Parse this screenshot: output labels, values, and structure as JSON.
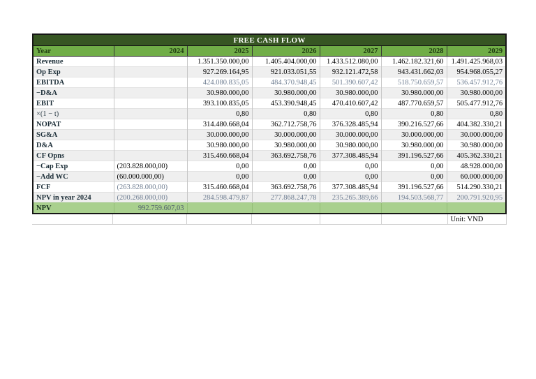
{
  "table": {
    "title": "FREE CASH FLOW",
    "unit_note": "Unit: VND",
    "header": {
      "label": "Year",
      "years": [
        "2024",
        "2025",
        "2026",
        "2027",
        "2028",
        "2029"
      ]
    },
    "rows": [
      {
        "label": "Revenue",
        "values": [
          "",
          "1.351.350.000,00",
          "1.405.404.000,00",
          "1.433.512.080,00",
          "1.462.182.321,60",
          "1.491.425.968,03"
        ],
        "muted": "none"
      },
      {
        "label": "Op Exp",
        "values": [
          "",
          "927.269.164,95",
          "921.033.051,55",
          "932.121.472,58",
          "943.431.662,03",
          "954.968.055,27"
        ],
        "muted": "none"
      },
      {
        "label": "EBITDA",
        "values": [
          "",
          "424.080.835,05",
          "484.370.948,45",
          "501.390.607,42",
          "518.750.659,57",
          "536.457.912,76"
        ],
        "muted": "all"
      },
      {
        "label": "−D&A",
        "values": [
          "",
          "30.980.000,00",
          "30.980.000,00",
          "30.980.000,00",
          "30.980.000,00",
          "30.980.000,00"
        ],
        "muted": "none"
      },
      {
        "label": "EBIT",
        "values": [
          "",
          "393.100.835,05",
          "453.390.948,45",
          "470.410.607,42",
          "487.770.659,57",
          "505.477.912,76"
        ],
        "muted": "none"
      },
      {
        "label": "×(1 − t)",
        "values": [
          "",
          "0,80",
          "0,80",
          "0,80",
          "0,80",
          "0,80"
        ],
        "muted": "none",
        "labelBold": false
      },
      {
        "label": "NOPAT",
        "values": [
          "",
          "314.480.668,04",
          "362.712.758,76",
          "376.328.485,94",
          "390.216.527,66",
          "404.382.330,21"
        ],
        "muted": "none"
      },
      {
        "label": "SG&A",
        "values": [
          "",
          "30.000.000,00",
          "30.000.000,00",
          "30.000.000,00",
          "30.000.000,00",
          "30.000.000,00"
        ],
        "muted": "none"
      },
      {
        "label": "D&A",
        "values": [
          "",
          "30.980.000,00",
          "30.980.000,00",
          "30.980.000,00",
          "30.980.000,00",
          "30.980.000,00"
        ],
        "muted": "none"
      },
      {
        "label": "CF Opns",
        "values": [
          "",
          "315.460.668,04",
          "363.692.758,76",
          "377.308.485,94",
          "391.196.527,66",
          "405.362.330,21"
        ],
        "muted": "none"
      },
      {
        "label": "−Cap Exp",
        "values": [
          "(203.828.000,00)",
          "0,00",
          "0,00",
          "0,00",
          "0,00",
          "48.928.000,00"
        ],
        "muted": "none",
        "firstLeft": true
      },
      {
        "label": "−Add WC",
        "values": [
          "(60.000.000,00)",
          "0,00",
          "0,00",
          "0,00",
          "0,00",
          "60.000.000,00"
        ],
        "muted": "none",
        "firstLeft": true
      },
      {
        "label": "FCF",
        "values": [
          "(263.828.000,00)",
          "315.460.668,04",
          "363.692.758,76",
          "377.308.485,94",
          "391.196.527,66",
          "514.290.330,21"
        ],
        "muted": "first",
        "firstLeft": true
      },
      {
        "label": "NPV in year 2024",
        "values": [
          "(200.268.000,00)",
          "284.598.479,87",
          "277.868.247,78",
          "235.265.389,66",
          "194.503.568,77",
          "200.791.920,95"
        ],
        "muted": "all",
        "firstLeft": true
      },
      {
        "label": "NPV",
        "values": [
          "992.759.607,03",
          "",
          "",
          "",
          "",
          ""
        ],
        "muted": "all",
        "highlight": true
      }
    ],
    "colors": {
      "title_bg": "#375623",
      "header_bg": "#70ad47",
      "highlight_bg": "#a9d08e",
      "stripe_bg": "#efefef",
      "muted_text": "#6f7e92"
    }
  }
}
